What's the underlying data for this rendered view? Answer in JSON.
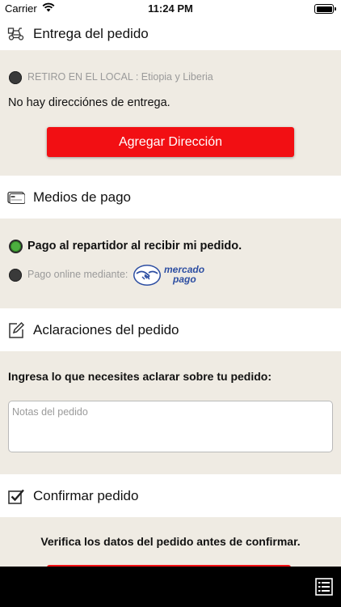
{
  "status_bar": {
    "carrier": "Carrier",
    "time": "11:24 PM"
  },
  "delivery": {
    "title": "Entrega del pedido",
    "pickup_option": "RETIRO EN EL LOCAL : Etiopia y Liberia",
    "no_address_text": "No hay direcciónes de entrega.",
    "add_address_button": "Agregar Dirección"
  },
  "payment": {
    "title": "Medios de pago",
    "option_cash": "Pago al repartidor al recibir mi pedido.",
    "option_online": "Pago online mediante:",
    "mercado_logo_line1": "mercado",
    "mercado_logo_line2": "pago"
  },
  "notes": {
    "title": "Aclaraciones del pedido",
    "prompt": "Ingresa lo que necesites aclarar sobre tu pedido:",
    "placeholder": "Notas del pedido"
  },
  "confirm": {
    "title": "Confirmar pedido",
    "verify_text": "Verifica los datos del pedido antes de confirmar."
  },
  "colors": {
    "accent_red": "#f20f13",
    "background": "#efebe3",
    "selected_green": "#4caf3f",
    "mercado_blue": "#2d4ea2"
  },
  "icons": [
    "wifi-icon",
    "battery-icon",
    "delivery-scooter-icon",
    "credit-card-icon",
    "edit-pencil-icon",
    "checkbox-checked-icon",
    "handshake-icon",
    "order-list-icon"
  ]
}
